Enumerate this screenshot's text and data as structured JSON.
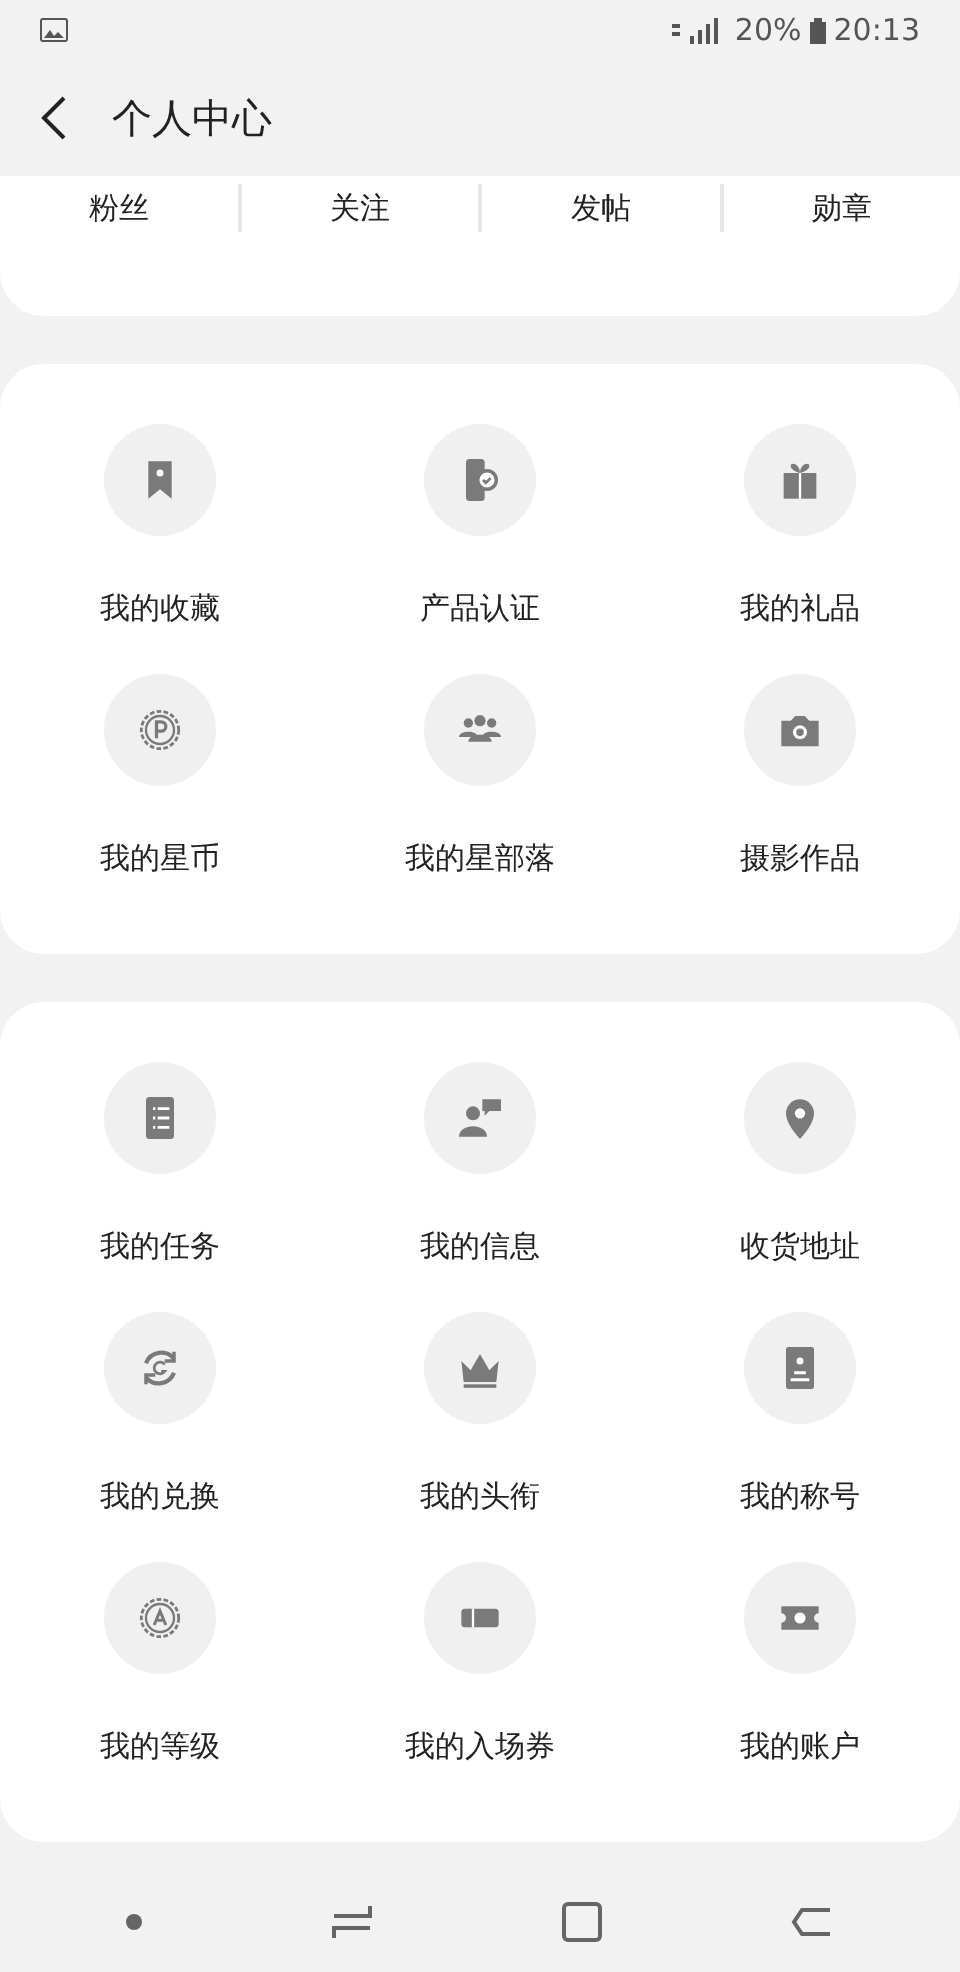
{
  "status_bar": {
    "battery": "20%",
    "time": "20:13"
  },
  "header": {
    "title": "个人中心"
  },
  "stats": [
    {
      "label": "粉丝"
    },
    {
      "label": "关注"
    },
    {
      "label": "发帖"
    },
    {
      "label": "勋章"
    }
  ],
  "sections": [
    {
      "items": [
        {
          "label": "我的收藏"
        },
        {
          "label": "产品认证"
        },
        {
          "label": "我的礼品"
        },
        {
          "label": "我的星币"
        },
        {
          "label": "我的星部落"
        },
        {
          "label": "摄影作品"
        }
      ]
    },
    {
      "items": [
        {
          "label": "我的任务"
        },
        {
          "label": "我的信息"
        },
        {
          "label": "收货地址"
        },
        {
          "label": "我的兑换"
        },
        {
          "label": "我的头衔"
        },
        {
          "label": "我的称号"
        },
        {
          "label": "我的等级"
        },
        {
          "label": "我的入场券"
        },
        {
          "label": "我的账户"
        }
      ]
    }
  ]
}
